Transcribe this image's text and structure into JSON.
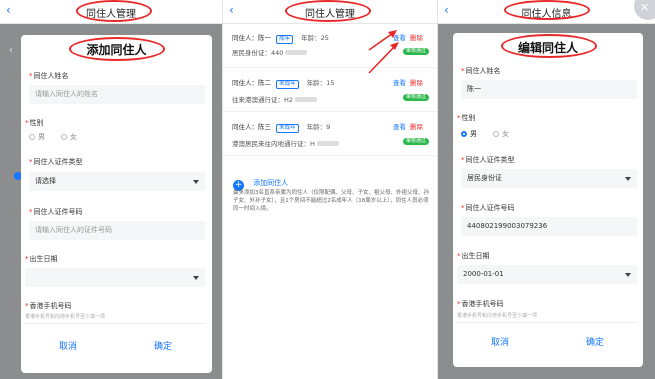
{
  "panel1": {
    "back": "‹",
    "title": "同住人管理",
    "modal": {
      "title": "添加同住人",
      "fields": [
        {
          "label": "同住人姓名",
          "placeholder": "请输入同住人的姓名"
        },
        {
          "label": "性别"
        },
        {
          "label": "同住人证件类型",
          "value": "请选择"
        },
        {
          "label": "同住人证件号码",
          "placeholder": "请输入同住人的证件号码"
        },
        {
          "label": "出生日期"
        },
        {
          "label": "香港手机号码",
          "hint": "香港手机号和内地手机号至少填一项"
        }
      ],
      "gender_options": [
        "男",
        "女"
      ],
      "cancel": "取消",
      "confirm": "确定"
    }
  },
  "panel2": {
    "back": "‹",
    "title": "同住人管理",
    "cards": [
      {
        "name": "同住人：陈一",
        "tag": "成年",
        "age": "年龄：25",
        "view": "查看",
        "delete": "删除",
        "doc": "居民身份证：440",
        "status": "审核通过"
      },
      {
        "name": "同住人：陈二",
        "tag": "未成年",
        "age": "年龄：15",
        "view": "查看",
        "delete": "删除",
        "doc": "往来港澳通行证：H2",
        "status": "审核通过"
      },
      {
        "name": "同住人：陈三",
        "tag": "未成年",
        "age": "年龄：9",
        "view": "查看",
        "delete": "删除",
        "doc": "港澳居民来往内地通行证：H",
        "status": "审核通过"
      }
    ],
    "add_label": "添加同住人",
    "add_icon": "plus-icon",
    "notice": "最多添加3名直系亲属为同住人（仅限配偶、父母、子女、祖父母、外祖父母、孙子女、外孙子女），且1个房间不能超过2名成年人（18周岁以上），同住人员必须同一时间入境。"
  },
  "panel3": {
    "back": "‹",
    "title": "同住人信息",
    "modal": {
      "title": "编辑同住人",
      "fields": [
        {
          "label": "同住人姓名",
          "value": "陈一"
        },
        {
          "label": "性别"
        },
        {
          "label": "同住人证件类型",
          "value": "居民身份证"
        },
        {
          "label": "同住人证件号码",
          "value": "440802199003079236"
        },
        {
          "label": "出生日期",
          "value": "2000-01-01"
        },
        {
          "label": "香港手机号码",
          "hint": "香港手机号和内地手机号至少填一项"
        }
      ],
      "gender_options": [
        "男",
        "女"
      ],
      "cancel": "取消",
      "confirm": "确定"
    }
  },
  "colors": {
    "accent": "#1677ff",
    "annotation_red": "#e8292b",
    "success_green": "#2db84d"
  }
}
